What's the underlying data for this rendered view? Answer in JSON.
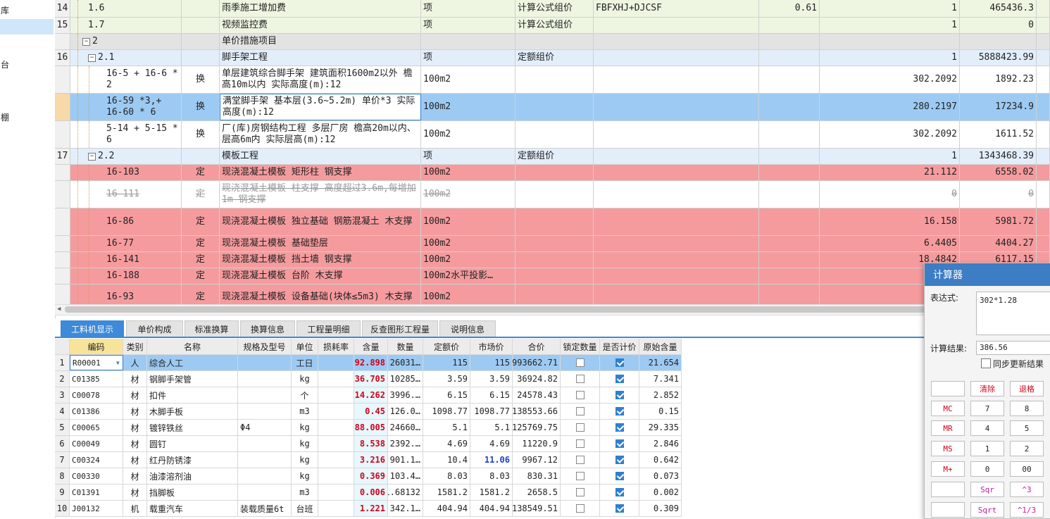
{
  "left_panel": {
    "items": [
      "库",
      "台",
      "棚"
    ]
  },
  "upper_rows": [
    {
      "rn": "14",
      "code": "1.6",
      "level": 1,
      "type": "",
      "name": "雨季施工增加费",
      "unit": "项",
      "method": "计算公式组价",
      "formula": "FBFXHJ+DJCSF",
      "rate": "0.61",
      "qty": "1",
      "total": "465436.3",
      "style": "lightgreen"
    },
    {
      "rn": "15",
      "code": "1.7",
      "level": 1,
      "type": "",
      "name": "视频监控费",
      "unit": "项",
      "method": "计算公式组价",
      "formula": "",
      "rate": "",
      "qty": "1",
      "total": "0",
      "style": "lightgreen"
    },
    {
      "rn": "",
      "code": "2",
      "level": 0,
      "expand": "−",
      "type": "",
      "name": "单价措施项目",
      "unit": "",
      "method": "",
      "formula": "",
      "rate": "",
      "qty": "",
      "total": "",
      "style": "gray"
    },
    {
      "rn": "16",
      "code": "2.1",
      "level": 1,
      "expand": "−",
      "type": "",
      "name": "脚手架工程",
      "unit": "项",
      "method": "定额组价",
      "formula": "",
      "rate": "",
      "qty": "1",
      "total": "5888423.99",
      "style": "lightblue"
    },
    {
      "rn": "",
      "code": "16-5 + 16-6 * 2",
      "level": 2,
      "type": "换",
      "name": "单层建筑综合脚手架 建筑面积1600m2以外 檐高10m以内  实际高度(m):12",
      "unit": "100m2",
      "method": "",
      "formula": "",
      "rate": "",
      "qty": "302.2092",
      "total": "1892.23",
      "style": "white"
    },
    {
      "rn": "",
      "code": "16-59 *3,+ 16-60 * 6",
      "level": 2,
      "type": "换",
      "name": "满堂脚手架 基本层(3.6~5.2m)  单价*3 实际高度(m):12",
      "unit": "100m2",
      "method": "",
      "formula": "",
      "rate": "",
      "qty": "280.2197",
      "total": "17234.9",
      "style": "selected"
    },
    {
      "rn": "",
      "code": "5-14 + 5-15 * 6",
      "level": 2,
      "type": "换",
      "name": "厂(库)房钢结构工程 多层厂房 檐高20m以内、层高6m内  实际层高(m):12",
      "unit": "100m2",
      "method": "",
      "formula": "",
      "rate": "",
      "qty": "302.2092",
      "total": "1611.52",
      "style": "white"
    },
    {
      "rn": "17",
      "code": "2.2",
      "level": 1,
      "expand": "−",
      "type": "",
      "name": "模板工程",
      "unit": "项",
      "method": "定额组价",
      "formula": "",
      "rate": "",
      "qty": "1",
      "total": "1343468.39",
      "style": "lightblue"
    },
    {
      "rn": "",
      "code": "16-103",
      "level": 2,
      "type": "定",
      "name": "现浇混凝土模板 矩形柱 钢支撑",
      "unit": "100m2",
      "method": "",
      "formula": "",
      "rate": "",
      "qty": "21.112",
      "total": "6558.02",
      "style": "red"
    },
    {
      "rn": "",
      "code": "16-111",
      "level": 2,
      "type": "定",
      "name": "现浇混凝土模板 柱支撑 高度超过3.6m,每增加1m 钢支撑",
      "unit": "100m2",
      "method": "",
      "formula": "",
      "rate": "",
      "qty": "0",
      "total": "0",
      "style": "strike"
    },
    {
      "rn": "",
      "code": "16-86",
      "level": 2,
      "type": "定",
      "name": "现浇混凝土模板 独立基础 钢筋混凝土 木支撑",
      "unit": "100m2",
      "method": "",
      "formula": "",
      "rate": "",
      "qty": "16.158",
      "total": "5981.72",
      "style": "red"
    },
    {
      "rn": "",
      "code": "16-77",
      "level": 2,
      "type": "定",
      "name": "现浇混凝土模板 基础垫层",
      "unit": "100m2",
      "method": "",
      "formula": "",
      "rate": "",
      "qty": "6.4405",
      "total": "4404.27",
      "style": "red"
    },
    {
      "rn": "",
      "code": "16-141",
      "level": 2,
      "type": "定",
      "name": "现浇混凝土模板 挡土墙 钢支撑",
      "unit": "100m2",
      "method": "",
      "formula": "",
      "rate": "",
      "qty": "18.4842",
      "total": "6117.15",
      "style": "red"
    },
    {
      "rn": "",
      "code": "16-188",
      "level": 2,
      "type": "定",
      "name": "现浇混凝土模板 台阶 木支撑",
      "unit": "100m2水平投影…",
      "method": "",
      "formula": "",
      "rate": "",
      "qty": "",
      "total": "",
      "style": "red"
    },
    {
      "rn": "",
      "code": "16-93",
      "level": 2,
      "type": "定",
      "name": "现浇混凝土模板 设备基础(块体≤5m3) 木支撑",
      "unit": "100m2",
      "method": "",
      "formula": "",
      "rate": "",
      "qty": "",
      "total": "",
      "style": "red"
    }
  ],
  "tabs": [
    "工料机显示",
    "单价构成",
    "标准换算",
    "换算信息",
    "工程量明细",
    "反查图形工程量",
    "说明信息"
  ],
  "lower_headers": [
    "编码",
    "类别",
    "名称",
    "规格及型号",
    "单位",
    "损耗率",
    "含量",
    "数量",
    "定额价",
    "市场价",
    "合价",
    "锁定数量",
    "是否计价",
    "原始含量"
  ],
  "lower_rows": [
    {
      "rn": "1",
      "code": "R00001",
      "cat": "人",
      "name": "综合人工",
      "spec": "",
      "unit": "工日",
      "loss": "",
      "content": "92.898",
      "qty": "26031…",
      "price": "115",
      "market": "115",
      "total": "2993662.71",
      "locked": false,
      "priced": true,
      "orig": "21.654"
    },
    {
      "rn": "2",
      "code": "C01385",
      "cat": "材",
      "name": "钢脚手架管",
      "spec": "",
      "unit": "kg",
      "loss": "",
      "content": "36.705",
      "qty": "10285…",
      "price": "3.59",
      "market": "3.59",
      "total": "36924.82",
      "locked": false,
      "priced": true,
      "orig": "7.341"
    },
    {
      "rn": "3",
      "code": "C00078",
      "cat": "材",
      "name": "扣件",
      "spec": "",
      "unit": "个",
      "loss": "",
      "content": "14.262",
      "qty": "3996.…",
      "price": "6.15",
      "market": "6.15",
      "total": "24578.43",
      "locked": false,
      "priced": true,
      "orig": "2.852"
    },
    {
      "rn": "4",
      "code": "C01386",
      "cat": "材",
      "name": "木脚手板",
      "spec": "",
      "unit": "m3",
      "loss": "",
      "content": "0.45",
      "qty": "126.0…",
      "price": "1098.77",
      "market": "1098.77",
      "total": "138553.66",
      "locked": false,
      "priced": true,
      "orig": "0.15"
    },
    {
      "rn": "5",
      "code": "C00065",
      "cat": "材",
      "name": "镀锌铁丝",
      "spec": "Φ4",
      "unit": "kg",
      "loss": "",
      "content": "88.005",
      "qty": "24660…",
      "price": "5.1",
      "market": "5.1",
      "total": "125769.75",
      "locked": false,
      "priced": true,
      "orig": "29.335"
    },
    {
      "rn": "6",
      "code": "C00049",
      "cat": "材",
      "name": "圆钉",
      "spec": "",
      "unit": "kg",
      "loss": "",
      "content": "8.538",
      "qty": "2392.…",
      "price": "4.69",
      "market": "4.69",
      "total": "11220.9",
      "locked": false,
      "priced": true,
      "orig": "2.846"
    },
    {
      "rn": "7",
      "code": "C00324",
      "cat": "材",
      "name": "红丹防锈漆",
      "spec": "",
      "unit": "kg",
      "loss": "",
      "content": "3.216",
      "qty": "901.1…",
      "price": "10.4",
      "market": "11.06",
      "market_blue": true,
      "total": "9967.12",
      "locked": false,
      "priced": true,
      "orig": "0.642"
    },
    {
      "rn": "8",
      "code": "C00330",
      "cat": "材",
      "name": "油漆溶剂油",
      "spec": "",
      "unit": "kg",
      "loss": "",
      "content": "0.369",
      "qty": "103.4…",
      "price": "8.03",
      "market": "8.03",
      "total": "830.31",
      "locked": false,
      "priced": true,
      "orig": "0.073"
    },
    {
      "rn": "9",
      "code": "C01391",
      "cat": "材",
      "name": "挡脚板",
      "spec": "",
      "unit": "m3",
      "loss": "",
      "content": "0.006",
      "qty": "1.68132",
      "price": "1581.2",
      "market": "1581.2",
      "total": "2658.5",
      "locked": false,
      "priced": true,
      "orig": "0.002"
    },
    {
      "rn": "10",
      "code": "J00132",
      "cat": "机",
      "name": "载重汽车",
      "spec": "装载质量6t",
      "unit": "台班",
      "loss": "",
      "content": "1.221",
      "qty": "342.1…",
      "price": "404.94",
      "market": "404.94",
      "total": "138549.51",
      "locked": false,
      "priced": true,
      "orig": "0.309"
    }
  ],
  "calculator": {
    "title": "计算器",
    "expr_label": "表达式:",
    "expr_value": "302*1.28",
    "result_label": "计算结果:",
    "result_value": "386.56",
    "sync_label": "同步更新结果",
    "buttons": [
      {
        "label": "",
        "color": "plain"
      },
      {
        "label": "清除",
        "color": "red"
      },
      {
        "label": "退格",
        "color": "red"
      },
      {
        "label": "MC",
        "color": "red"
      },
      {
        "label": "7",
        "color": "plain"
      },
      {
        "label": "8",
        "color": "plain"
      },
      {
        "label": "MR",
        "color": "red"
      },
      {
        "label": "4",
        "color": "plain"
      },
      {
        "label": "5",
        "color": "plain"
      },
      {
        "label": "MS",
        "color": "red"
      },
      {
        "label": "1",
        "color": "plain"
      },
      {
        "label": "2",
        "color": "plain"
      },
      {
        "label": "M+",
        "color": "red"
      },
      {
        "label": "0",
        "color": "plain"
      },
      {
        "label": "00",
        "color": "plain"
      },
      {
        "label": "",
        "color": "plain"
      },
      {
        "label": "Sqr",
        "color": "pink"
      },
      {
        "label": "^3",
        "color": "pink"
      },
      {
        "label": "",
        "color": "plain"
      },
      {
        "label": "Sqrt",
        "color": "pink"
      },
      {
        "label": "^1/3",
        "color": "pink"
      }
    ]
  },
  "colors": {
    "lightgreen": "#eef6e2",
    "gray": "#e3e3e3",
    "lightblue": "#e3eefb",
    "white": "#ffffff",
    "selected": "#9dcaf3",
    "red": "#f59b9e",
    "strike": "#ffffff",
    "tab_active": "#3c8ad8",
    "calc_title": "#3d7dc4"
  }
}
